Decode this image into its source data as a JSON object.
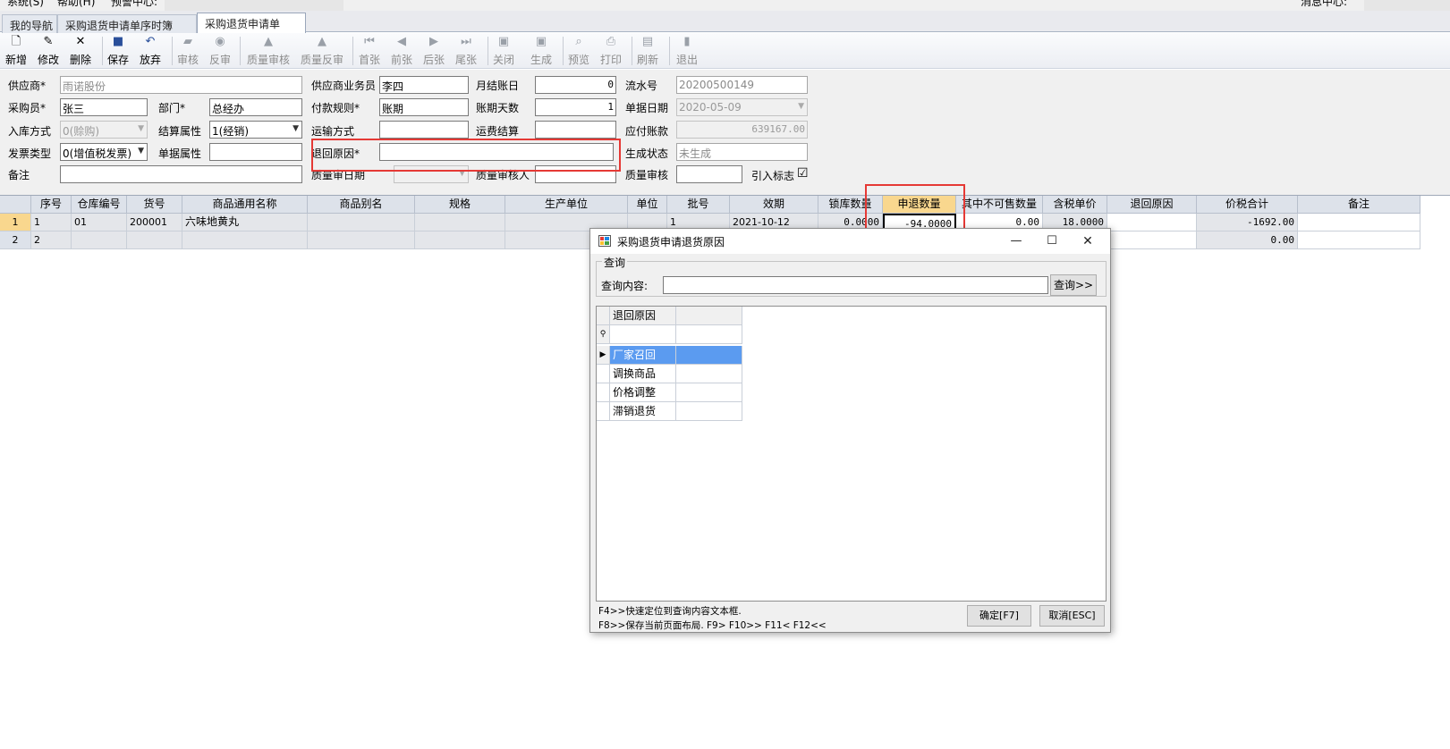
{
  "menubar": {
    "system": "系统(S)",
    "help": "帮助(H)",
    "warning": "预警中心:",
    "message": "消息中心:"
  },
  "tabs": [
    {
      "label": "我的导航"
    },
    {
      "label": "采购退货申请单序时簿"
    },
    {
      "label": "采购退货申请单"
    }
  ],
  "toolbar": {
    "new": "新增",
    "edit": "修改",
    "delete": "删除",
    "save": "保存",
    "discard": "放弃",
    "audit": "审核",
    "unaudit": "反审",
    "quality_audit": "质量审核",
    "quality_unaudit": "质量反审",
    "first": "首张",
    "prev": "前张",
    "next": "后张",
    "last": "尾张",
    "close": "关闭",
    "generate": "生成",
    "preview": "预览",
    "print": "打印",
    "refresh": "刷新",
    "exit": "退出"
  },
  "form": {
    "supplier_label": "供应商*",
    "supplier_value": "雨诺股份",
    "buyer_label": "采购员*",
    "buyer_value": "张三",
    "dept_label": "部门*",
    "dept_value": "总经办",
    "instock_label": "入库方式",
    "instock_value": "0(赊购)",
    "settle_attr_label": "结算属性",
    "settle_attr_value": "1(经销)",
    "invoice_label": "发票类型",
    "invoice_value": "0(增值税发票)",
    "doc_attr_label": "单据属性",
    "doc_attr_value": "",
    "remark_label": "备注",
    "remark_value": "",
    "sup_staff_label": "供应商业务员",
    "sup_staff_value": "李四",
    "pay_rule_label": "付款规则*",
    "pay_rule_value": "账期",
    "transport_label": "运输方式",
    "transport_value": "",
    "reason_label": "退回原因*",
    "reason_value": "",
    "qa_date_label": "质量审日期",
    "qa_date_value": "",
    "month_day_label": "月结账日",
    "month_day_value": "0",
    "days_label": "账期天数",
    "days_value": "1",
    "freight_label": "运费结算",
    "freight_value": "",
    "qa_person_label": "质量审核人",
    "qa_person_value": "",
    "serial_label": "流水号",
    "serial_value": "20200500149",
    "doc_date_label": "单据日期",
    "doc_date_value": "2020-05-09",
    "payable_label": "应付账款",
    "payable_value": "639167.00",
    "gen_status_label": "生成状态",
    "gen_status_value": "未生成",
    "qa_label": "质量审核",
    "qa_value": "",
    "import_label": "引入标志",
    "import_checked": "☑"
  },
  "grid": {
    "columns": [
      "序号",
      "仓库编号",
      "货号",
      "商品通用名称",
      "商品别名",
      "规格",
      "生产单位",
      "单位",
      "批号",
      "效期",
      "锁库数量",
      "申退数量",
      "其中不可售数量",
      "含税单价",
      "退回原因",
      "价税合计",
      "备注"
    ],
    "rows": [
      {
        "rownum": "1",
        "seq": "1",
        "wh": "01",
        "code": "200001",
        "name": "六味地黄丸",
        "alias": "",
        "spec": "",
        "maker": "",
        "unit": "",
        "batch": "1",
        "expiry": "2021-10-12",
        "locked": "0.0000",
        "qty": "-94.0000",
        "unsaleable": "0.00",
        "price": "18.0000",
        "reason": "",
        "total": "-1692.00",
        "note": ""
      },
      {
        "rownum": "2",
        "seq": "2",
        "wh": "",
        "code": "",
        "name": "",
        "alias": "",
        "spec": "",
        "maker": "",
        "unit": "",
        "batch": "",
        "expiry": "",
        "locked": "",
        "qty": "",
        "unsaleable": "",
        "price": "",
        "reason": "",
        "total": "0.00",
        "note": ""
      }
    ]
  },
  "dialog": {
    "title": "采购退货申请退货原因",
    "group_title": "查询",
    "query_label": "查询内容:",
    "query_value": "",
    "query_button": "查询>>",
    "list_header": "退回原因",
    "items": [
      "厂家召回",
      "调换商品",
      "价格调整",
      "滞销退货"
    ],
    "hint1": "F4>>快速定位到查询内容文本框.",
    "hint2": "F8>>保存当前页面布局.  F9> F10>> F11< F12<<",
    "ok_button": "确定[F7]",
    "cancel_button": "取消[ESC]",
    "minimize": "—",
    "maximize": "☐",
    "close": "✕"
  },
  "colors": {
    "highlight_red": "#e53935",
    "selected_header": "#f9d78e",
    "selected_row": "#5b9bf0"
  }
}
